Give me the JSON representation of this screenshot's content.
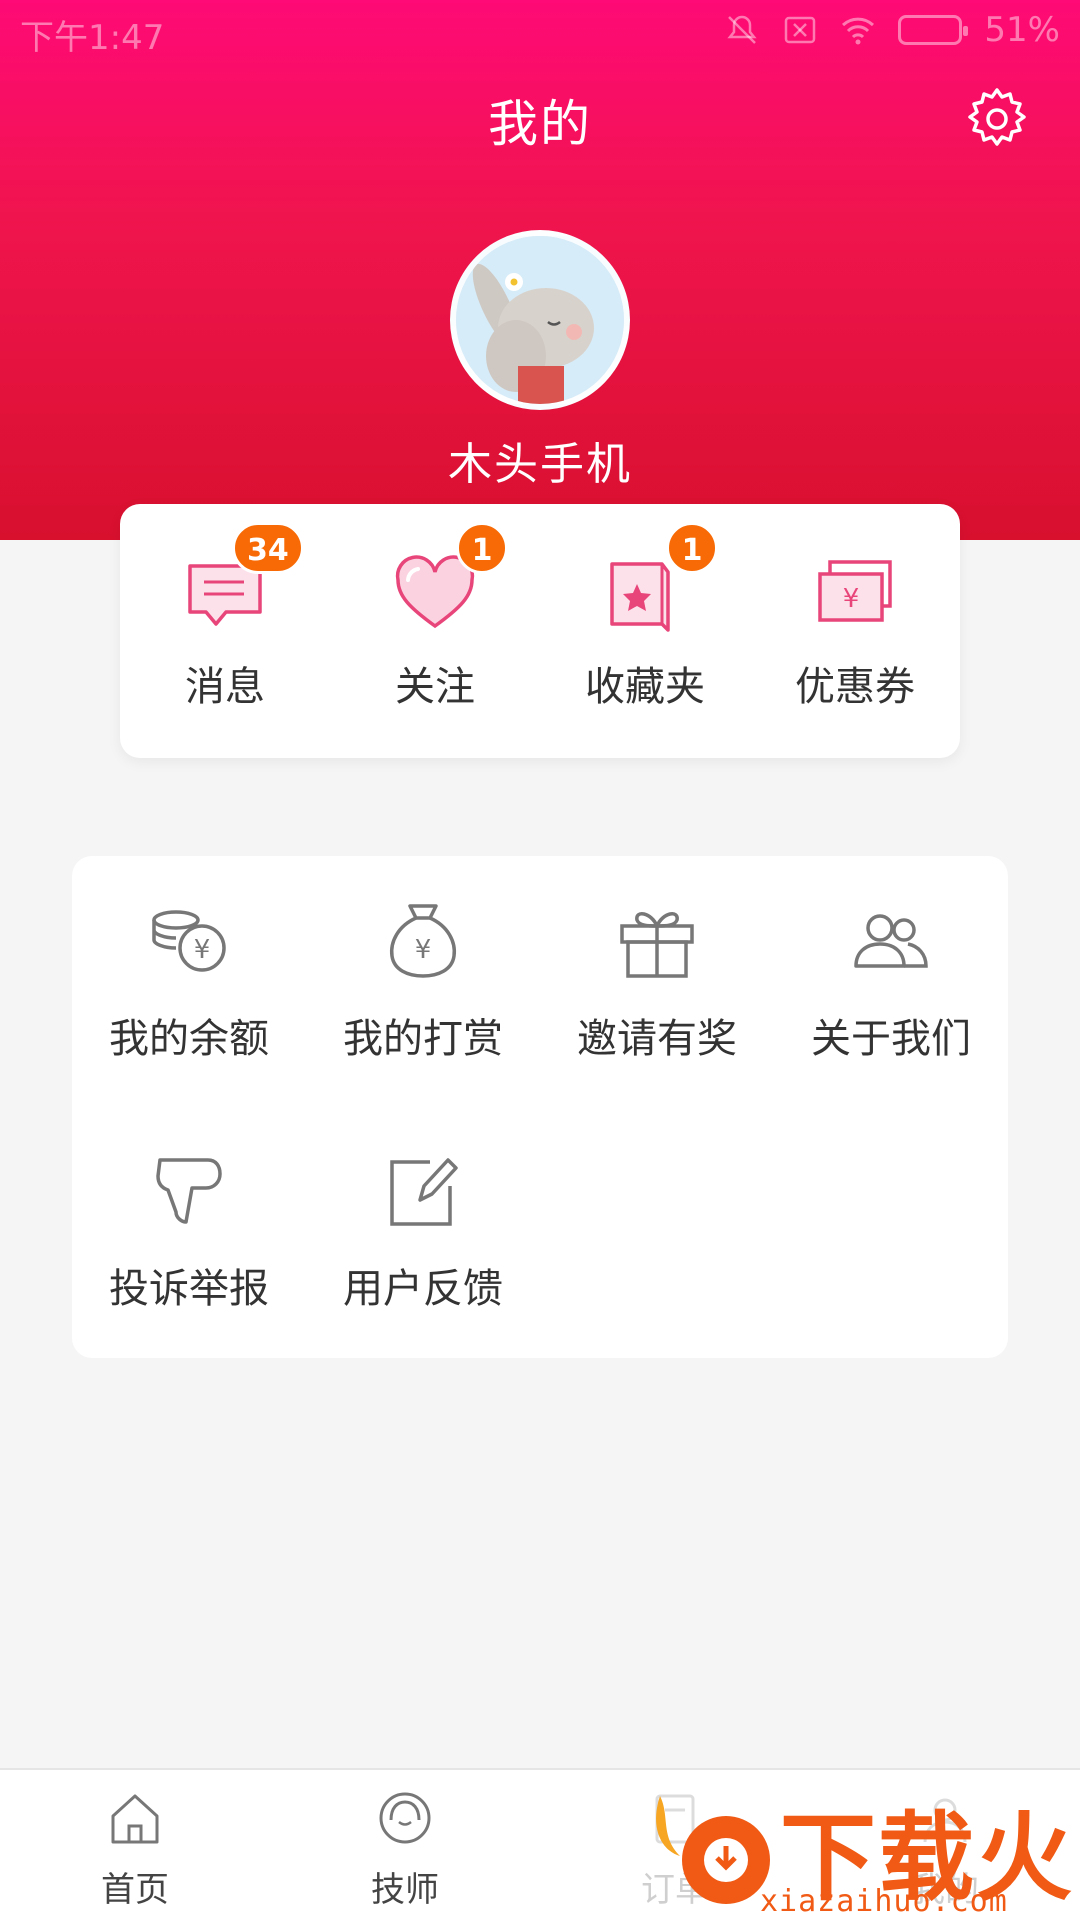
{
  "status_bar": {
    "time": "下午1:47",
    "battery": "51%"
  },
  "header": {
    "title": "我的"
  },
  "profile": {
    "username": "木头手机"
  },
  "quick_actions": [
    {
      "label": "消息",
      "badge": "34",
      "icon": "message-icon"
    },
    {
      "label": "关注",
      "badge": "1",
      "icon": "heart-icon"
    },
    {
      "label": "收藏夹",
      "badge": "1",
      "icon": "favorites-icon"
    },
    {
      "label": "优惠券",
      "badge": "",
      "icon": "coupon-icon"
    }
  ],
  "menu": [
    {
      "label": "我的余额",
      "icon": "coins-yen-icon"
    },
    {
      "label": "我的打赏",
      "icon": "money-bag-icon"
    },
    {
      "label": "邀请有奖",
      "icon": "gift-icon"
    },
    {
      "label": "关于我们",
      "icon": "users-icon"
    },
    {
      "label": "投诉举报",
      "icon": "thumbs-down-icon"
    },
    {
      "label": "用户反馈",
      "icon": "edit-icon"
    }
  ],
  "tabbar": [
    {
      "label": "首页",
      "icon": "home-icon"
    },
    {
      "label": "技师",
      "icon": "technician-icon"
    },
    {
      "label": "订单",
      "icon": "order-icon"
    },
    {
      "label": "我的",
      "icon": "profile-icon"
    }
  ],
  "watermark": {
    "text": "下载火",
    "url": "xiazaihuo.com"
  },
  "colors": {
    "accent": "#f0144e",
    "badge": "#f76a05",
    "icon_pink": "#e8457a",
    "icon_gray": "#777777"
  }
}
